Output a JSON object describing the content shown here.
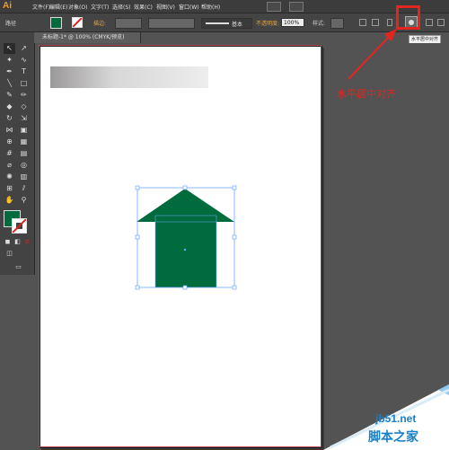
{
  "app": {
    "logo": "Ai"
  },
  "menu": {
    "items": [
      "文件(F)",
      "编辑(E)",
      "对象(O)",
      "文字(T)",
      "选择(S)",
      "效果(C)",
      "视图(V)",
      "窗口(W)",
      "帮助(H)"
    ]
  },
  "control_bar": {
    "selection_label": "路径",
    "stroke_label": "描边:",
    "brush_label": "基本",
    "opacity_label": "不透明度:",
    "opacity_value": "100%",
    "style_label": "样式:",
    "fill_color": "#006b3c",
    "halign_tooltip": "水平居中对齐"
  },
  "document": {
    "tab_title": "未标题-1* @ 100% (CMYK/预览)",
    "tab_close": "×"
  },
  "artwork": {
    "house_color": "#006b3c",
    "gradient_from": "#9a9898",
    "gradient_to": "#ededed"
  },
  "annotation": {
    "text": "水平居中对齐",
    "color": "#e2261f"
  },
  "watermark": {
    "url": "jb51.net",
    "text": "脚本之家"
  }
}
